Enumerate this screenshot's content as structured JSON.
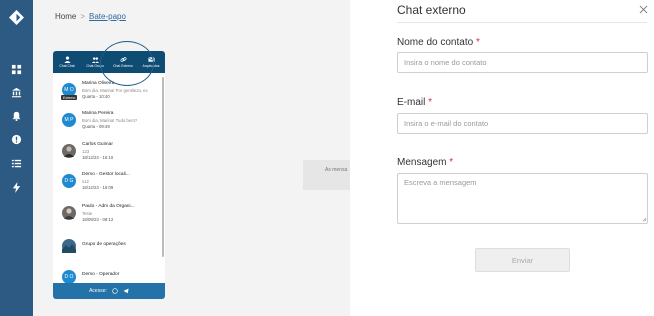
{
  "breadcrumb": {
    "home": "Home",
    "separator": ">",
    "current": "Bate-papo"
  },
  "rail_icons": [
    "logo-icon",
    "dashboard-icon",
    "bank-icon",
    "bell-icon",
    "alert-icon",
    "list-icon",
    "lightning-icon"
  ],
  "widget": {
    "tabs": [
      {
        "label": "Chat Chat",
        "icon": "person-icon"
      },
      {
        "label": "Chat Grupo",
        "icon": "group-icon"
      },
      {
        "label": "Chat Externo",
        "icon": "link-icon"
      },
      {
        "label": "Arquivados",
        "icon": "mail-icon"
      }
    ],
    "chats": [
      {
        "initials": "M O",
        "name": "Marina Oliveira",
        "line2": "Bom dia, Marina! Por gentileza, ex",
        "line3": "Quarta - 10:40",
        "badge": "Externo"
      },
      {
        "initials": "M P",
        "name": "Marina Pereira",
        "line2": "Bom dia, Marina! Tudo bem?",
        "line3": "Quarta - 09:49"
      },
      {
        "initials": "",
        "name": "Carlos Guimar",
        "line2": "123",
        "line3": "18/12/23 - 16:10"
      },
      {
        "initials": "D G",
        "name": "Demo - Gestor locali...",
        "line2": "s12",
        "line3": "18/12/23 - 16:09"
      },
      {
        "initials": "",
        "name": "Paulo - Adm da Organi...",
        "line2": "Teste",
        "line3": "18/09/23 - 08:12"
      },
      {
        "initials": "",
        "name": "Grupo de operações",
        "line2": "",
        "line3": ""
      },
      {
        "initials": "D O",
        "name": "Demo - Operador",
        "line2": "",
        "line3": ""
      }
    ],
    "footer_label": "Acesse:"
  },
  "background_message": "As mensa",
  "panel": {
    "title": "Chat externo",
    "fields": {
      "name": {
        "label": "Nome do contato",
        "required_mark": "*",
        "placeholder": "Insira o nome do contato",
        "value": ""
      },
      "email": {
        "label": "E-mail",
        "required_mark": "*",
        "placeholder": "Insira o e-mail do contato",
        "value": ""
      },
      "message": {
        "label": "Mensagem",
        "required_mark": "*",
        "placeholder": "Escreva a mensagem",
        "value": ""
      }
    },
    "send_label": "Enviar"
  },
  "colors": {
    "rail": "#2d5a82",
    "widget_header": "#0f4c74",
    "widget_footer": "#2473a8",
    "avatar": "#1f8ad0",
    "required": "#d0303a"
  }
}
